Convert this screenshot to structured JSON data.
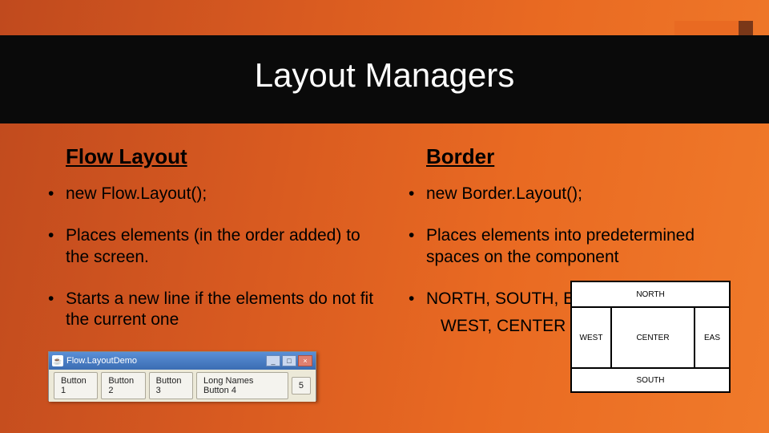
{
  "title": "Layout Managers",
  "left": {
    "heading": "Flow Layout",
    "bullets": [
      "new Flow.Layout();",
      "Places elements (in the order added) to the screen.",
      "Starts a new line if the elements do not fit the current one"
    ]
  },
  "right": {
    "heading": "Border",
    "bullets": [
      "new Border.Layout();",
      "Places elements into predetermined spaces on the component",
      "NORTH, SOUTH, EAST,"
    ],
    "bullet3_line2": "WEST, CENTER"
  },
  "flowdemo": {
    "title": "Flow.LayoutDemo",
    "buttons": [
      "Button 1",
      "Button 2",
      "Button 3",
      "Long Names Button 4",
      "5"
    ]
  },
  "borderdiagram": {
    "north": "NORTH",
    "west": "WEST",
    "center": "CENTER",
    "east": "EAS",
    "south": "SOUTH"
  }
}
